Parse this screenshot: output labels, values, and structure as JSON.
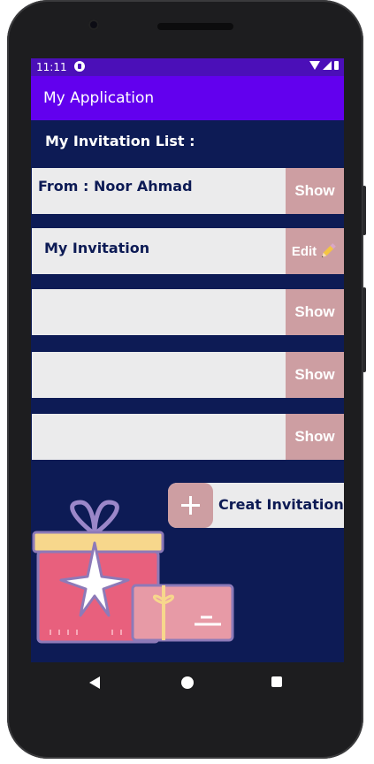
{
  "status_bar": {
    "time": "11:11"
  },
  "app_bar": {
    "title": "My Application"
  },
  "list": {
    "title": "My Invitation List  :",
    "rows": [
      {
        "label": "From : Noor Ahmad",
        "button": "Show"
      },
      {
        "label": "My Invitation",
        "button": "Edit"
      },
      {
        "label": "",
        "button": "Show"
      },
      {
        "label": "",
        "button": "Show"
      },
      {
        "label": "",
        "button": "Show"
      }
    ]
  },
  "create_button": {
    "label": "Creat Invitation"
  },
  "colors": {
    "status_bar": "#4b0fb8",
    "app_bar": "#6200ee",
    "background": "#0d1b55",
    "button": "#cd9ea2",
    "row": "#ebebec"
  },
  "icons": [
    "pencil-icon",
    "plus-icon",
    "gift-illustration",
    "back-icon",
    "home-icon",
    "recents-icon"
  ]
}
